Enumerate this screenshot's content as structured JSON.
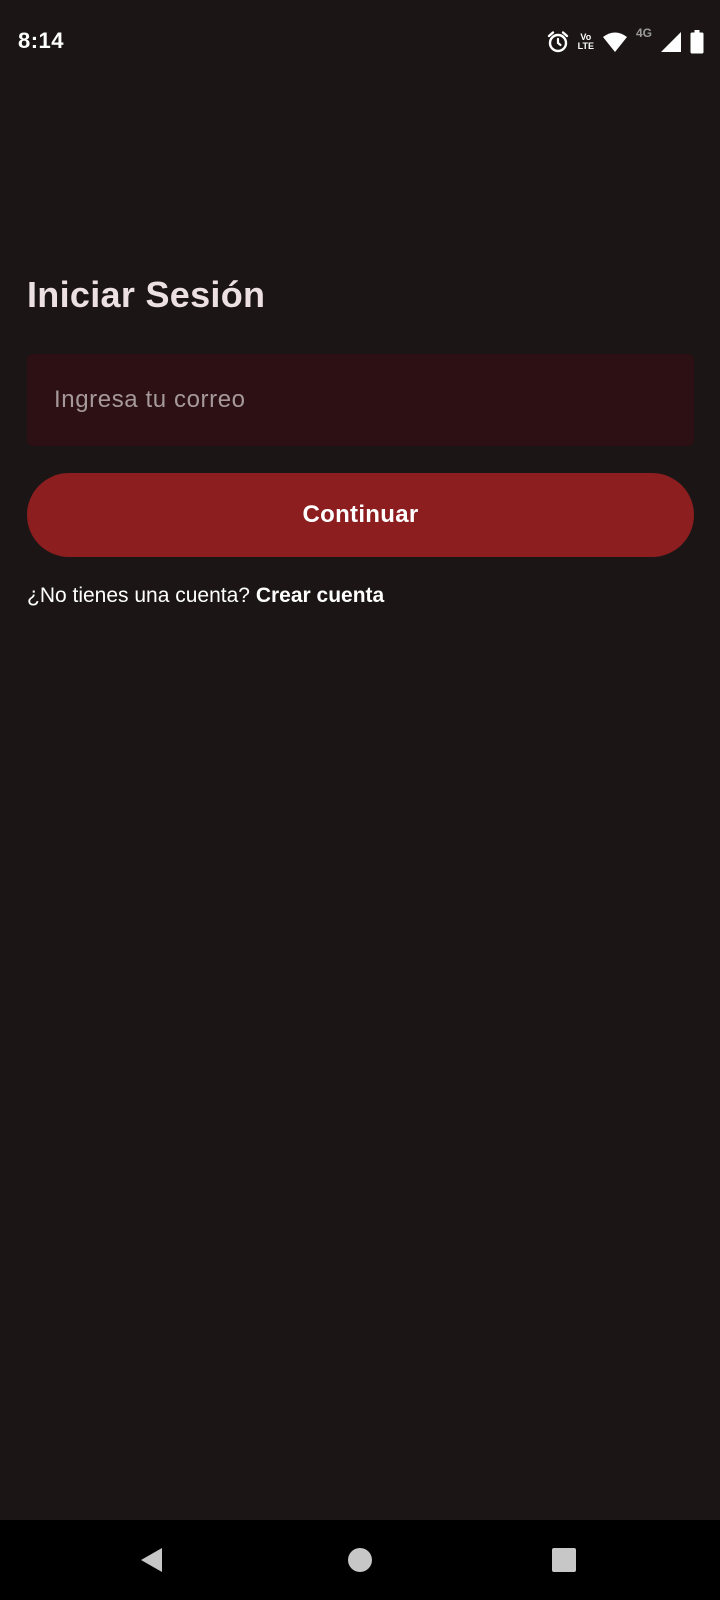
{
  "status_bar": {
    "time": "8:14",
    "volte_top": "Vo",
    "volte_bottom": "LTE",
    "network_type": "4G",
    "icons": [
      "alarm-icon",
      "volte-icon",
      "wifi-icon",
      "network-4g-icon",
      "signal-icon",
      "battery-icon"
    ]
  },
  "login": {
    "title": "Iniciar Sesión",
    "email_placeholder": "Ingresa tu correo",
    "email_value": "",
    "continue_label": "Continuar",
    "signup_prompt": "¿No tienes una cuenta?",
    "signup_link": "Crear cuenta"
  },
  "nav_bar": {
    "icons": [
      "back-icon",
      "home-icon",
      "recents-icon"
    ]
  },
  "colors": {
    "background": "#1b1516",
    "input_background": "#2c1013",
    "primary_button": "#8c1e1f",
    "title_text": "#ece0e3",
    "placeholder_text": "#a6999b",
    "nav_bar": "#000000"
  }
}
